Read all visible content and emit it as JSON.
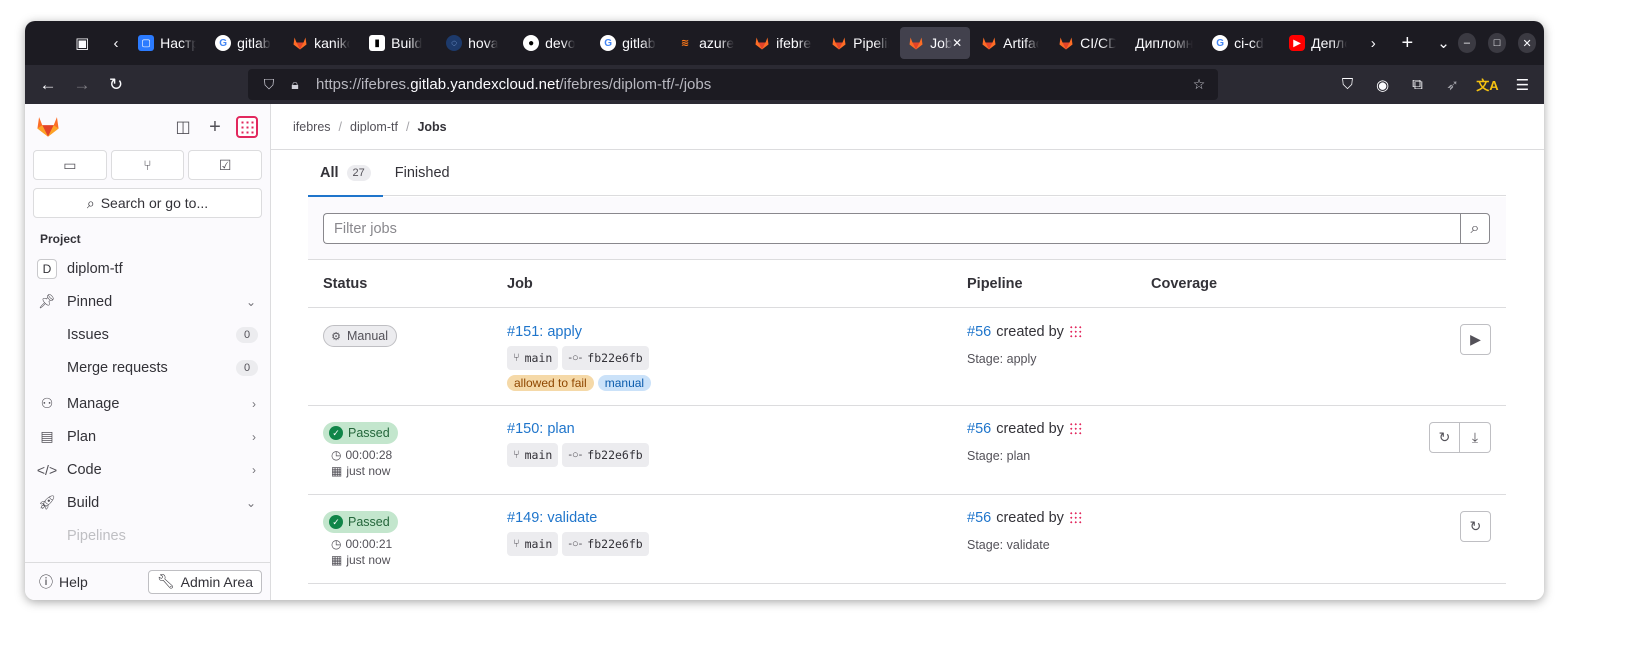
{
  "browser": {
    "tabs": [
      {
        "label": "Настройки",
        "icon": "blue-square-icon"
      },
      {
        "label": "gitlab",
        "icon": "google-icon"
      },
      {
        "label": "kaniko",
        "icon": "gitlab-icon"
      },
      {
        "label": "Build",
        "icon": "book-icon"
      },
      {
        "label": "hova",
        "icon": "devops-icon"
      },
      {
        "label": "devo",
        "icon": "github-icon"
      },
      {
        "label": "gitlab",
        "icon": "google-icon"
      },
      {
        "label": "azure",
        "icon": "azure-icon"
      },
      {
        "label": "ifebres",
        "icon": "gitlab-icon"
      },
      {
        "label": "Pipelines",
        "icon": "gitlab-icon"
      },
      {
        "label": "Jobs",
        "icon": "gitlab-icon",
        "active": true
      },
      {
        "label": "Artifacts",
        "icon": "gitlab-icon"
      },
      {
        "label": "CI/CD",
        "icon": "gitlab-icon"
      },
      {
        "label": "Дипломная",
        "icon": ""
      },
      {
        "label": "ci-cd",
        "icon": "google-icon"
      },
      {
        "label": "Деплой",
        "icon": "youtube-icon"
      }
    ],
    "url_prefix": "https://ifebres.",
    "url_host": "gitlab.yandexcloud.net",
    "url_path": "/ifebres/diplom-tf/-/jobs"
  },
  "sidebar": {
    "search_label": "Search or go to...",
    "section_title": "Project",
    "project_initial": "D",
    "project_name": "diplom-tf",
    "pinned_label": "Pinned",
    "pinned_items": [
      {
        "label": "Issues",
        "count": "0"
      },
      {
        "label": "Merge requests",
        "count": "0"
      }
    ],
    "nav_items": [
      {
        "label": "Manage"
      },
      {
        "label": "Plan"
      },
      {
        "label": "Code"
      },
      {
        "label": "Build"
      }
    ],
    "faded_item": "Pipelines",
    "help_label": "Help",
    "admin_label": "Admin Area"
  },
  "breadcrumb": {
    "items": [
      "ifebres",
      "diplom-tf"
    ],
    "current": "Jobs"
  },
  "tabs": {
    "all_label": "All",
    "all_count": "27",
    "finished_label": "Finished"
  },
  "filter": {
    "placeholder": "Filter jobs"
  },
  "table": {
    "headers": {
      "status": "Status",
      "job": "Job",
      "pipeline": "Pipeline",
      "coverage": "Coverage"
    },
    "rows": [
      {
        "status": "Manual",
        "duration": "",
        "finished": "",
        "job": "#151: apply",
        "branch": "main",
        "commit": "fb22e6fb",
        "labels": [
          "allowed to fail",
          "manual"
        ],
        "pipeline": "#56",
        "created_by": "created by",
        "stage": "Stage: apply"
      },
      {
        "status": "Passed",
        "duration": "00:00:28",
        "finished": "just now",
        "job": "#150: plan",
        "branch": "main",
        "commit": "fb22e6fb",
        "labels": [],
        "pipeline": "#56",
        "created_by": "created by",
        "stage": "Stage: plan"
      },
      {
        "status": "Passed",
        "duration": "00:00:21",
        "finished": "just now",
        "job": "#149: validate",
        "branch": "main",
        "commit": "fb22e6fb",
        "labels": [],
        "pipeline": "#56",
        "created_by": "created by",
        "stage": "Stage: validate"
      }
    ]
  },
  "colors": {
    "link": "#1f75cb",
    "passed": "#108548",
    "gitlab_orange": "#fc6d26"
  }
}
